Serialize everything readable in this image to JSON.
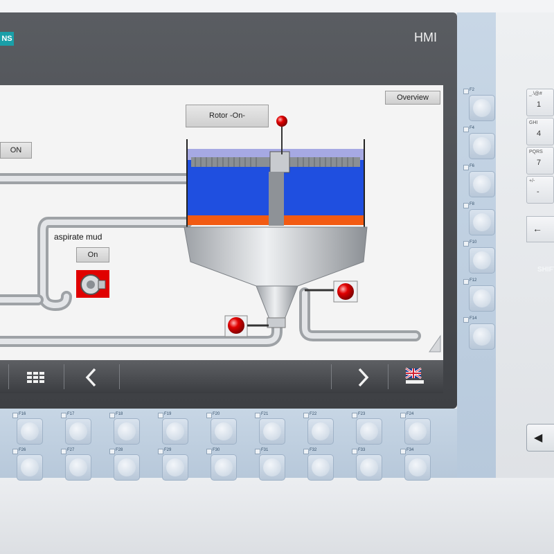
{
  "device": {
    "brand": "NS",
    "model": "HMI"
  },
  "screen": {
    "overview_button": "Overview",
    "rotor_button": "Rotor -On-",
    "on_button_top": "ON",
    "aspirate_label": "aspirate mud",
    "aspirate_button": "On"
  },
  "navbar": {
    "items": [
      "grid-menu",
      "previous",
      "next",
      "language-uk"
    ]
  },
  "function_keys": {
    "side": [
      "F2",
      "F4",
      "F6",
      "F8",
      "F10",
      "F12",
      "F14"
    ],
    "row1": [
      "F16",
      "F17",
      "F18",
      "F19",
      "F20",
      "F21",
      "F22",
      "F23",
      "F24"
    ],
    "row2": [
      "F26",
      "F27",
      "F28",
      "F29",
      "F30",
      "F31",
      "F32",
      "F33",
      "F34"
    ]
  },
  "keypad": {
    "keys": [
      {
        "sub": "_.\\@#",
        "main": "1"
      },
      {
        "sub": "GHI",
        "main": "4"
      },
      {
        "sub": "PQRS",
        "main": "7"
      },
      {
        "sub": "+/-",
        "main": "-"
      }
    ],
    "shift_label": "SHIFT"
  },
  "colors": {
    "pipe": "#b9bcc0",
    "tank_water": "#1f4fe0",
    "sludge": "#f25a12",
    "alarm_red": "#e00000",
    "bezel": "#4a4c50"
  }
}
